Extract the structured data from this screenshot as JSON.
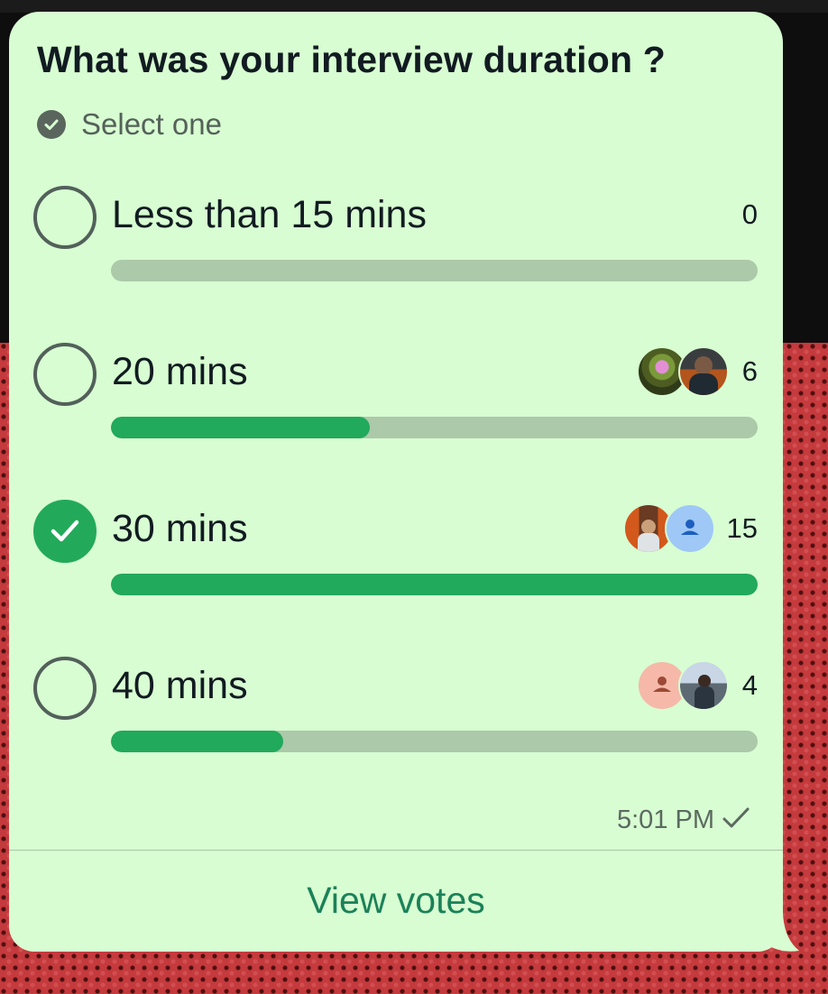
{
  "poll": {
    "question": "What was your interview duration ?",
    "select_hint": "Select one",
    "options": [
      {
        "label": "Less than 15 mins",
        "count": "0",
        "fraction": 0.0,
        "selected": false,
        "avatars": []
      },
      {
        "label": "20 mins",
        "count": "6",
        "fraction": 0.4,
        "selected": false,
        "avatars": [
          "flowers-photo",
          "person-photo"
        ]
      },
      {
        "label": "30 mins",
        "count": "15",
        "fraction": 1.0,
        "selected": true,
        "avatars": [
          "torii-gate-photo",
          "default-person"
        ]
      },
      {
        "label": "40 mins",
        "count": "4",
        "fraction": 0.267,
        "selected": false,
        "avatars": [
          "default-person-peach",
          "city-photo"
        ]
      }
    ],
    "time": "5:01 PM",
    "status_icon": "sent-check-icon",
    "view_votes_label": "View votes"
  },
  "colors": {
    "bubble": "#d8fdd2",
    "accent_green": "#21a95c",
    "bar_track": "#acc9a9",
    "link_green": "#1b8158"
  }
}
